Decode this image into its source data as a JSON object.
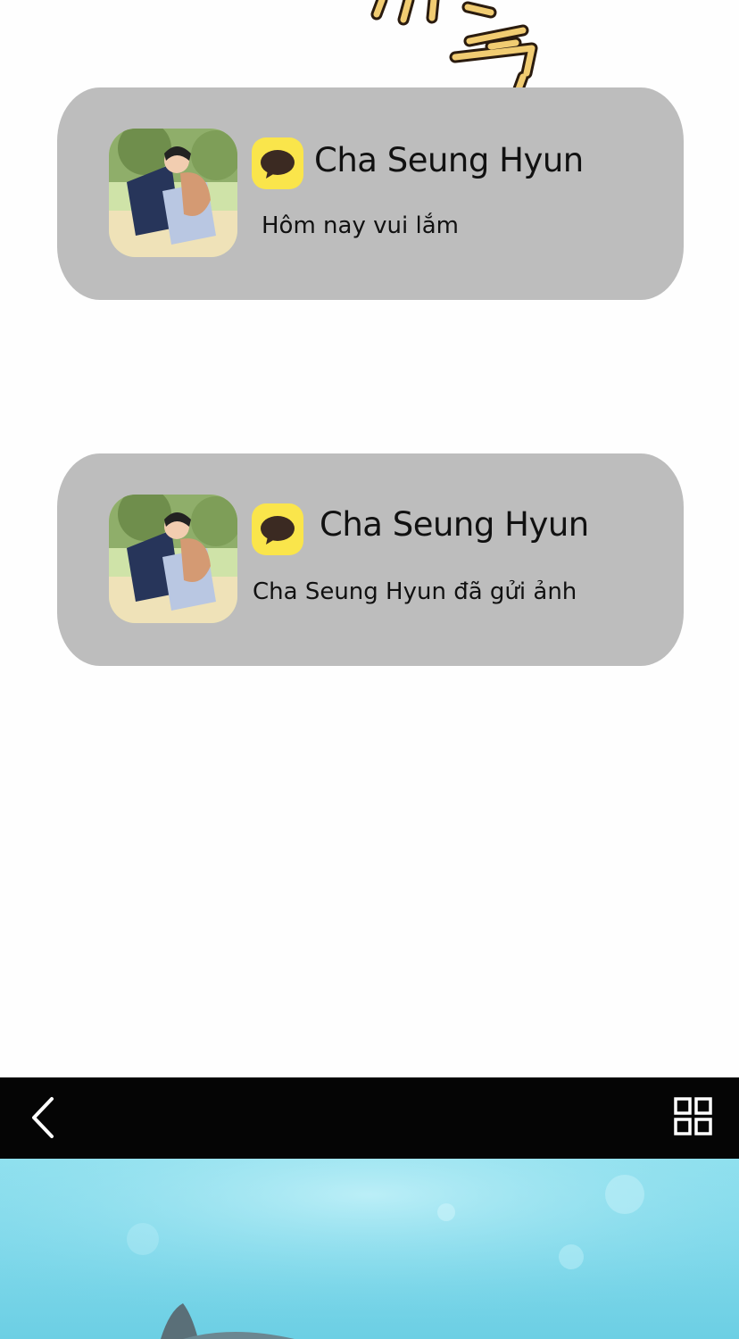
{
  "notifications": [
    {
      "sender": "Cha Seung Hyun",
      "message": "Hôm nay vui lắm",
      "app_icon": "chat-bubble-icon",
      "avatar": "illustration of two people hugging on a park bench"
    },
    {
      "sender": "Cha Seung Hyun",
      "message": "Cha Seung Hyun đã gửi ảnh",
      "app_icon": "chat-bubble-icon",
      "avatar": "illustration of two people hugging on a park bench"
    }
  ],
  "viewer_toolbar": {
    "back_icon": "chevron-left-icon",
    "grid_icon": "grid-icon"
  },
  "colors": {
    "card_background": "#bdbdbd",
    "app_icon_background": "#fae54b",
    "toolbar_background": "#050505",
    "photo_water": "#8fe0ee",
    "sfx_lettering": "#f1cc72"
  }
}
